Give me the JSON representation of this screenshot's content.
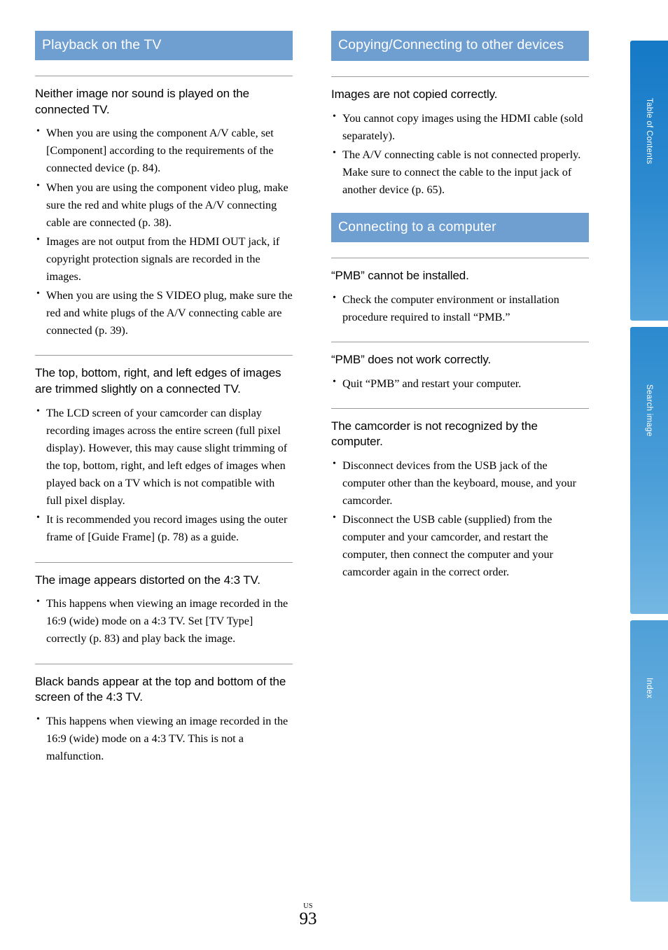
{
  "page": {
    "number": "93",
    "region_label": "US"
  },
  "side_tabs": [
    {
      "label": "Table of Contents",
      "name": "tab-table-of-contents"
    },
    {
      "label": "Search image",
      "name": "tab-search-image"
    },
    {
      "label": "Index",
      "name": "tab-index"
    }
  ],
  "left_column": {
    "section_title": "Playback on the TV",
    "blocks": [
      {
        "heading": "Neither image nor sound is played on the connected TV.",
        "bullets": [
          "When you are using the component A/V cable, set [Component] according to the requirements of the connected device (p. 84).",
          "When you are using the component video plug, make sure the red and white plugs of the A/V connecting cable are connected (p. 38).",
          "Images are not output from the HDMI OUT jack, if copyright protection signals are recorded in the images.",
          "When you are using the S VIDEO plug, make sure the red and white plugs of the A/V connecting cable are connected (p. 39)."
        ]
      },
      {
        "heading": "The top, bottom, right, and left edges of images are trimmed slightly on a connected TV.",
        "bullets": [
          "The LCD screen of your camcorder can display recording images across the entire screen (full pixel display). However, this may cause slight trimming of the top, bottom, right, and left edges of images when played back on a TV which is not compatible with full pixel display.",
          "It is recommended you record images using the outer frame of [Guide Frame] (p. 78) as a guide."
        ]
      },
      {
        "heading": "The image appears distorted on the 4:3 TV.",
        "bullets": [
          "This happens when viewing an image recorded in the 16:9 (wide) mode on a 4:3 TV. Set [TV Type] correctly (p. 83) and play back the image."
        ]
      },
      {
        "heading": "Black bands appear at the top and bottom of the screen of the 4:3 TV.",
        "bullets": [
          "This happens when viewing an image recorded in the 16:9 (wide) mode on a 4:3 TV. This is not a malfunction."
        ]
      }
    ]
  },
  "right_column": {
    "section_title_1": "Copying/Connecting to other devices",
    "blocks_1": [
      {
        "heading": "Images are not copied correctly.",
        "bullets": [
          "You cannot copy images using the HDMI cable (sold separately).",
          "The A/V connecting cable is not connected properly. Make sure to connect the cable to the input jack of another device (p. 65)."
        ]
      }
    ],
    "section_title_2": "Connecting to a computer",
    "blocks_2": [
      {
        "heading": "“PMB” cannot be installed.",
        "bullets": [
          "Check the computer environment or installation procedure required to install “PMB.”"
        ]
      },
      {
        "heading": "“PMB” does not work correctly.",
        "bullets": [
          "Quit “PMB” and restart your computer."
        ]
      },
      {
        "heading": "The camcorder is not recognized by the computer.",
        "bullets": [
          "Disconnect devices from the USB jack of the computer other than the keyboard, mouse, and your camcorder.",
          "Disconnect the USB cable (supplied) from the computer and your camcorder, and restart the computer, then connect the computer and your camcorder again in the correct order."
        ]
      }
    ]
  },
  "colors": {
    "section_header_bg": "#6f9fd0",
    "tab_toc": "#1579c6",
    "tab_search": "#3d96d4",
    "tab_index": "#6fb4e1"
  }
}
